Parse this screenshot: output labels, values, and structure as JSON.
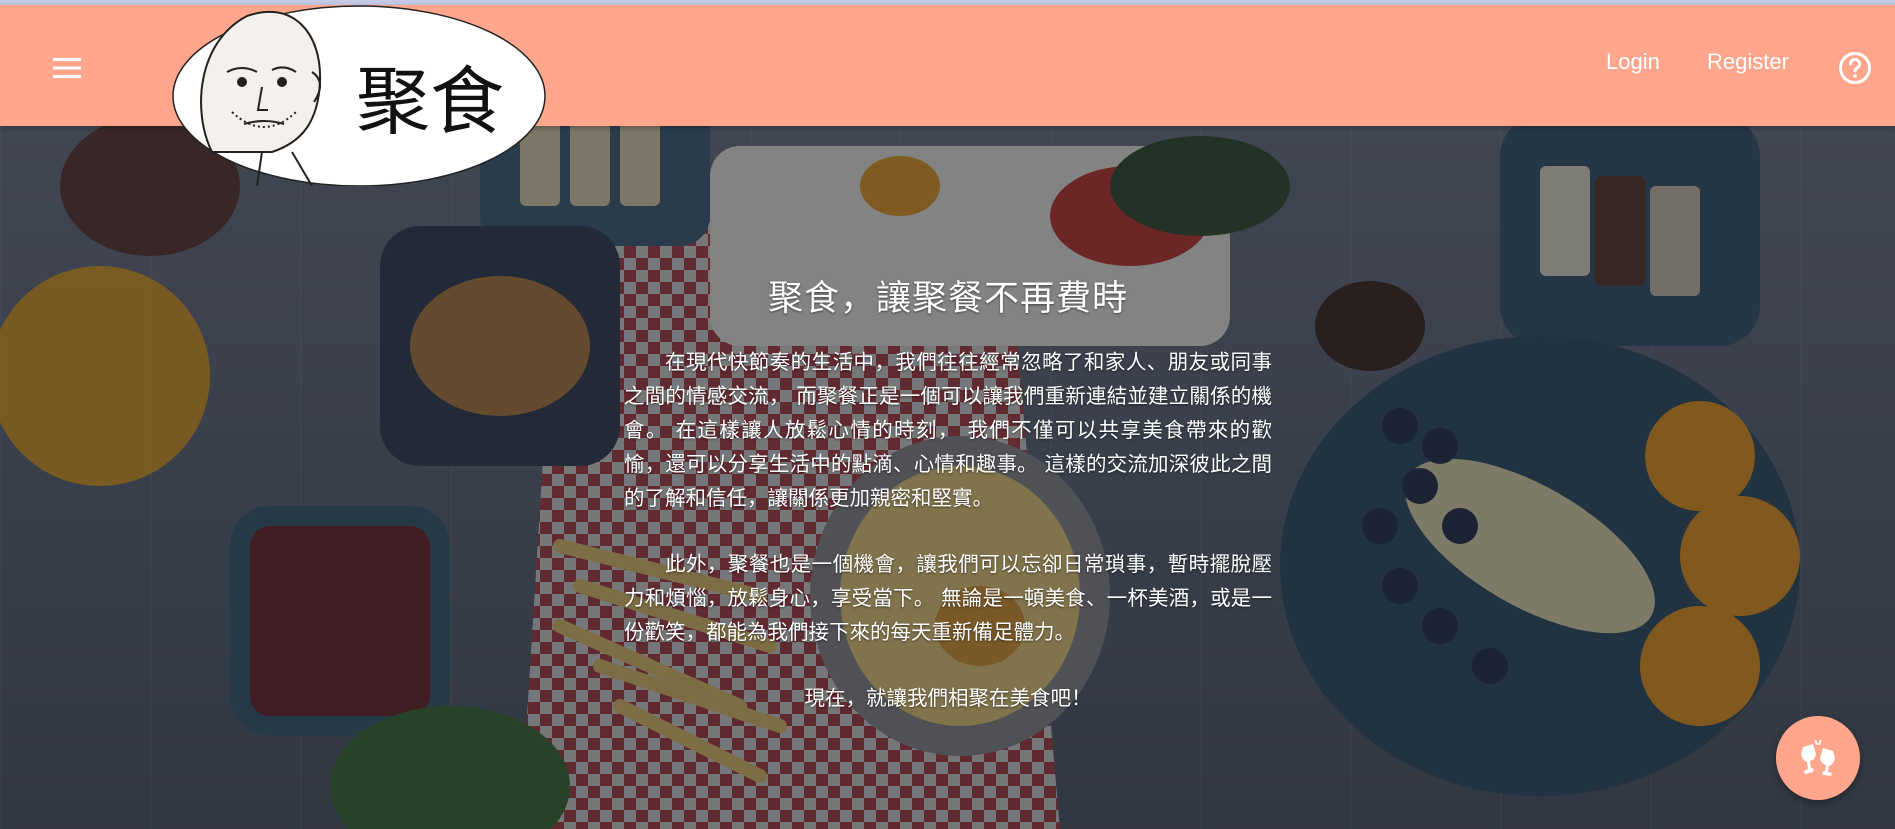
{
  "brand": {
    "logo_text": "聚食",
    "logo_icon": "cartoon-face-logo"
  },
  "header": {
    "menu_icon": "hamburger-menu-icon",
    "login_label": "Login",
    "register_label": "Register",
    "help_icon": "help-circle-icon"
  },
  "hero": {
    "headline": "聚食，讓聚餐不再費時",
    "paragraph1": "在現代快節奏的生活中，我們往往經常忽略了和家人、朋友或同事之間的情感交流， 而聚餐正是一個可以讓我們重新連結並建立關係的機會。 在這樣讓人放鬆心情的時刻， 我們不僅可以共享美食帶來的歡愉，還可以分享生活中的點滴、心情和趣事。 這樣的交流加深彼此之間的了解和信任，讓關係更加親密和堅實。",
    "paragraph2": "此外，聚餐也是一個機會，讓我們可以忘卻日常瑣事，暫時擺脫壓力和煩惱，放鬆身心，享受當下。 無論是一頓美食、一杯美酒，或是一份歡笑，都能為我們接下來的每天重新備足體力。",
    "closing": "現在，就讓我們相聚在美食吧！"
  },
  "fab": {
    "icon": "cheers-glasses-icon"
  },
  "colors": {
    "header": "#ffa68c",
    "fab": "#ffa68c",
    "text": "#ffffff",
    "overlay": "rgba(25,28,35,0.52)"
  }
}
